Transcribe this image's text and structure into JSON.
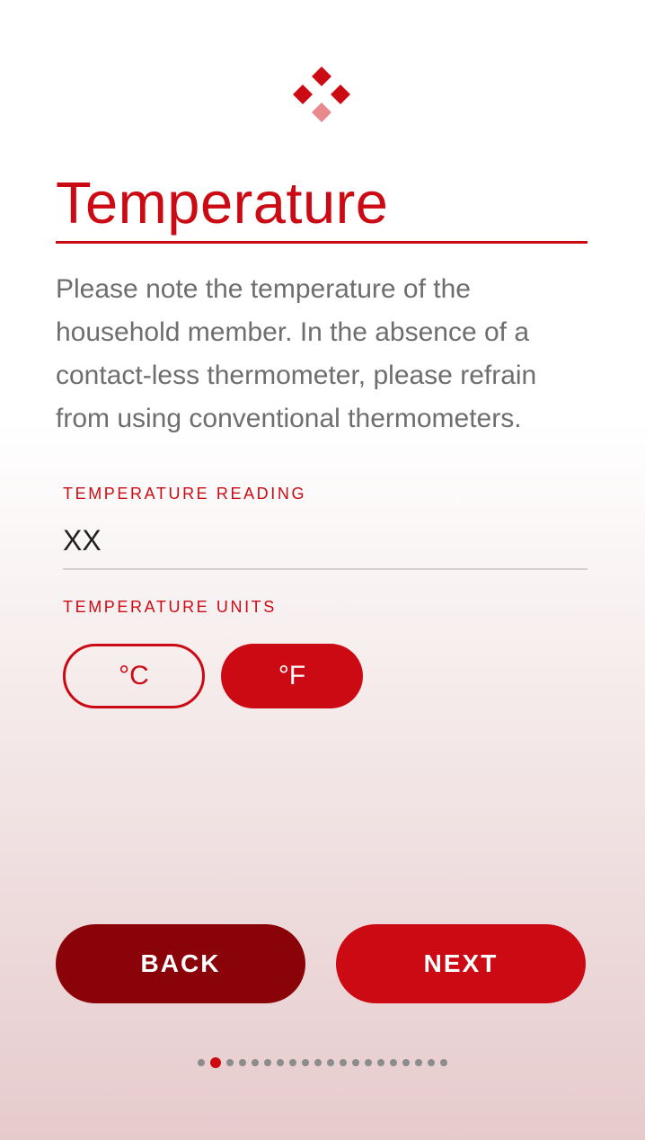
{
  "logo": {
    "icon": "diamond-cluster-logo",
    "primary_color": "#cc0a14",
    "secondary_color": "#e88a8d"
  },
  "page": {
    "title": "Temperature",
    "description": "Please note the temperature of the household member. In the absence of a contact-less thermometer, please refrain from using conventional thermometers."
  },
  "reading": {
    "label": "TEMPERATURE READING",
    "value": "XX"
  },
  "units": {
    "label": "TEMPERATURE UNITS",
    "options": [
      {
        "label": "°C",
        "selected": false
      },
      {
        "label": "°F",
        "selected": true
      }
    ]
  },
  "navigation": {
    "back_label": "BACK",
    "next_label": "NEXT"
  },
  "pager": {
    "total": 20,
    "current": 2
  },
  "colors": {
    "accent": "#cc0a14",
    "back_button": "#8a0309",
    "body_text": "#6e6e6e",
    "inactive_dot": "#8c8c8c"
  }
}
